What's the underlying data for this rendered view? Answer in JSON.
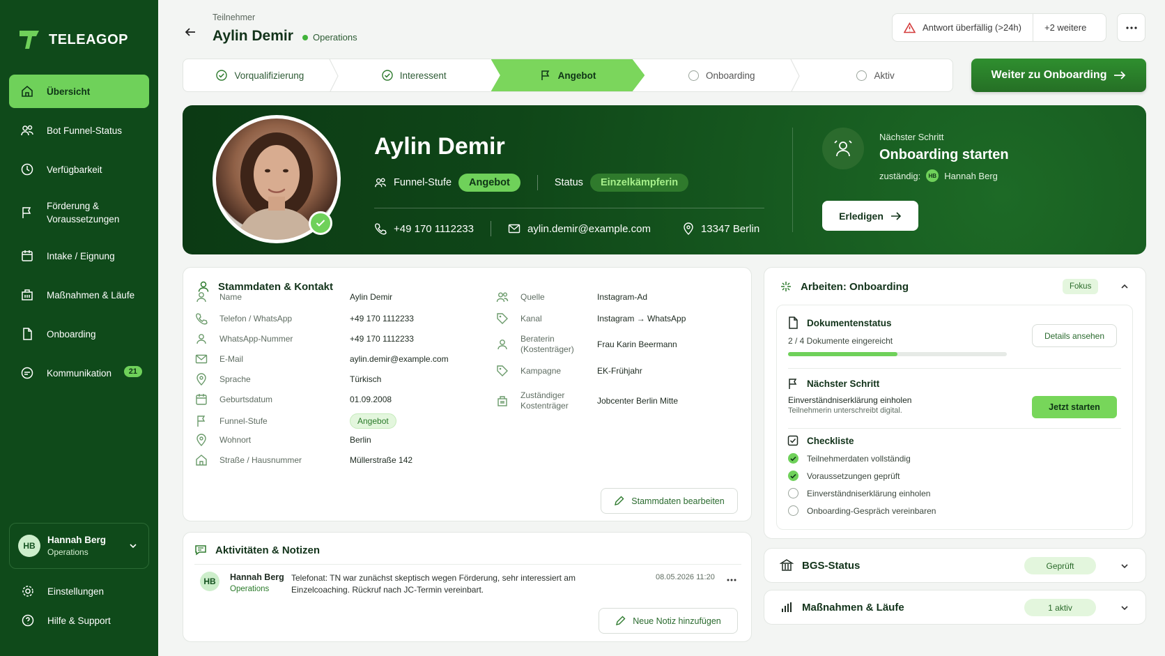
{
  "app": {
    "name": "TELEAGOP"
  },
  "sidebar": {
    "items": [
      {
        "label": "Übersicht",
        "icon": "home-icon"
      },
      {
        "label": "Bot Funnel-Status",
        "icon": "users-icon"
      },
      {
        "label": "Verfügbarkeit",
        "icon": "clock-icon"
      },
      {
        "label": "Förderung & Voraussetzungen",
        "icon": "flag-icon"
      },
      {
        "label": "Intake / Eignung",
        "icon": "calendar-icon"
      },
      {
        "label": "Maßnahmen & Läufe",
        "icon": "building-icon"
      },
      {
        "label": "Onboarding",
        "icon": "document-icon"
      },
      {
        "label": "Kommunikation",
        "icon": "chat-icon",
        "badge": "21"
      }
    ],
    "user": {
      "initials": "HB",
      "name": "Hannah Berg",
      "role": "Operations"
    },
    "settings_label": "Einstellungen",
    "help_label": "Hilfe & Support"
  },
  "header": {
    "breadcrumb": "Teilnehmer",
    "title": "Aylin Demir",
    "team": "Operations",
    "alert": "Antwort überfällig (>24h)",
    "alert_more": "+2 weitere"
  },
  "stepper": {
    "steps": [
      {
        "label": "Vorqualifizierung",
        "state": "done"
      },
      {
        "label": "Interessent",
        "state": "done"
      },
      {
        "label": "Angebot",
        "state": "active"
      },
      {
        "label": "Onboarding",
        "state": "todo"
      },
      {
        "label": "Aktiv",
        "state": "todo"
      }
    ],
    "cta_label": "Weiter zu Onboarding"
  },
  "hero": {
    "name": "Aylin Demir",
    "funnel_label": "Funnel-Stufe",
    "funnel_value": "Angebot",
    "status_label": "Status",
    "status_value": "Einzelkämpferin",
    "phone": "+49 170 1112233",
    "email": "aylin.demir@example.com",
    "location": "13347 Berlin",
    "next_label": "Nächster Schritt",
    "next_title": "Onboarding starten",
    "owner_label": "zuständig:",
    "owner_initials": "HB",
    "owner_name": "Hannah Berg",
    "done_label": "Erledigen"
  },
  "stammdaten": {
    "title": "Stammdaten & Kontakt",
    "left": [
      {
        "label": "Name",
        "value": "Aylin Demir",
        "icon": "user-icon"
      },
      {
        "label": "Telefon / WhatsApp",
        "value": "+49 170 1112233",
        "icon": "phone-icon"
      },
      {
        "label": "WhatsApp-Nummer",
        "value": "+49 170 1112233",
        "icon": "user-icon"
      },
      {
        "label": "E-Mail",
        "value": "aylin.demir@example.com",
        "icon": "mail-icon"
      },
      {
        "label": "Sprache",
        "value": "Türkisch",
        "icon": "pin-icon"
      },
      {
        "label": "Geburtsdatum",
        "value": "01.09.2008",
        "icon": "calendar-icon"
      },
      {
        "label": "Funnel-Stufe",
        "value": "Angebot",
        "icon": "flag-icon"
      },
      {
        "label": "Wohnort",
        "value": "Berlin",
        "icon": "pin-icon"
      },
      {
        "label": "Straße / Hausnummer",
        "value": "Müllerstraße 142",
        "icon": "home-icon"
      }
    ],
    "right": [
      {
        "label": "Quelle",
        "value": "Instagram-Ad",
        "icon": "users-icon"
      },
      {
        "label": "Kanal",
        "value": "Instagram → WhatsApp",
        "icon": "tag-icon"
      },
      {
        "label": "Beraterin (Kostenträger)",
        "value": "Frau Karin Beermann",
        "icon": "user-icon"
      },
      {
        "label": "Kampagne",
        "value": "EK-Frühjahr",
        "icon": "tag-icon"
      },
      {
        "label": "Zuständiger Kostenträger",
        "value": "Jobcenter Berlin Mitte",
        "icon": "building-icon"
      }
    ],
    "edit_label": "Stammdaten bearbeiten"
  },
  "activities": {
    "title": "Aktivitäten & Notizen",
    "entry": {
      "initials": "HB",
      "name": "Hannah Berg",
      "role": "Operations",
      "text": "Telefonat: TN war zunächst skeptisch wegen Förderung, sehr interessiert am Einzelcoaching. Rückruf nach JC-Termin vereinbart.",
      "time": "08.05.2026 11:20"
    },
    "add_label": "Neue Notiz hinzufügen"
  },
  "work": {
    "title": "Arbeiten: Onboarding",
    "focus": "Fokus",
    "docs_title": "Dokumentenstatus",
    "docs_text": "2 / 4 Dokumente eingereicht",
    "docs_progress": 0.5,
    "docs_button": "Details ansehen",
    "next_title": "Nächster Schritt",
    "next_main": "Einverständniserklärung einholen",
    "next_sub": "Teilnehmerin unterschreibt digital.",
    "next_button": "Jetzt starten",
    "checklist_title": "Checkliste",
    "checklist": [
      {
        "label": "Teilnehmerdaten vollständig",
        "done": true
      },
      {
        "label": "Voraussetzungen geprüft",
        "done": true
      },
      {
        "label": "Einverständniserklärung einholen",
        "done": false
      },
      {
        "label": "Onboarding-Gespräch vereinbaren",
        "done": false
      }
    ]
  },
  "bgs": {
    "title": "BGS-Status",
    "badge": "Geprüft"
  },
  "massnahmen": {
    "title": "Maßnahmen & Läufe",
    "badge": "1 aktiv"
  },
  "colors": {
    "sidebar": "#0f4a1a",
    "accent": "#6fd15a",
    "primary": "#2e8b2e",
    "alert": "#d33a3a"
  }
}
